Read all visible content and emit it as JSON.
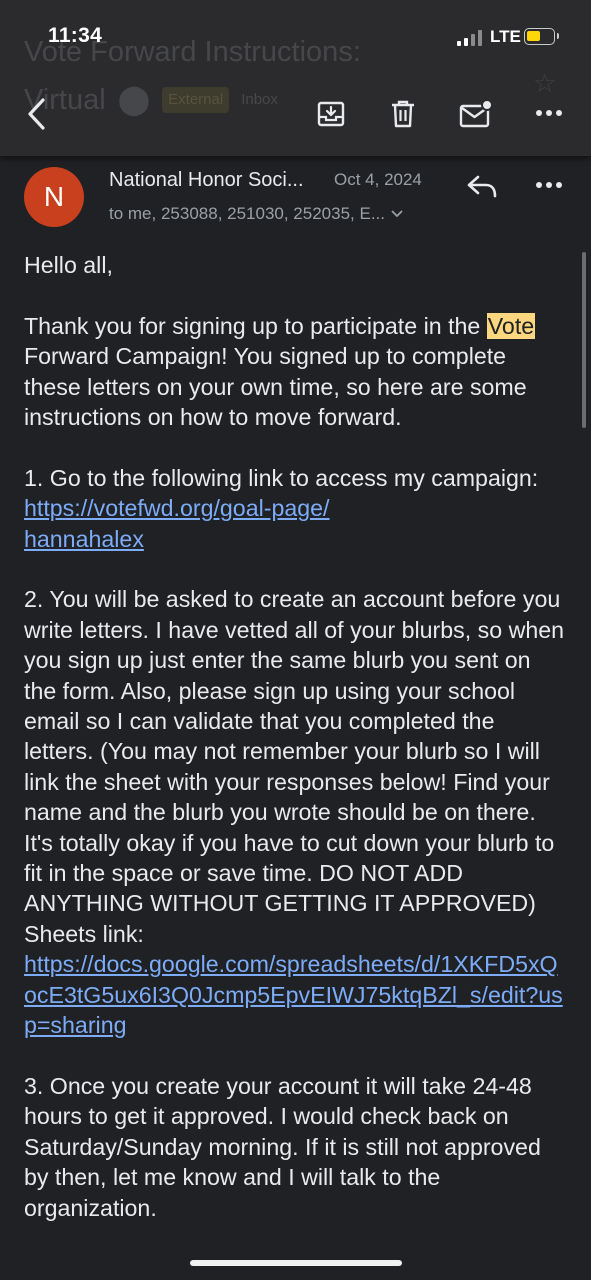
{
  "status_bar": {
    "time": "11:34",
    "network": "LTE"
  },
  "ghost_subject": {
    "line1": "Vote Forward Instructions:",
    "line2": "Virtual",
    "badge": "External",
    "label": "Inbox"
  },
  "toolbar": {
    "back_icon": "chevron-left-icon",
    "archive_icon": "archive-icon",
    "delete_icon": "trash-icon",
    "mark_unread_icon": "mail-unread-icon",
    "more_icon": "more-horizontal-icon"
  },
  "message": {
    "avatar_letter": "N",
    "avatar_color": "#c8401e",
    "sender": "National Honor Soci...",
    "date": "Oct 4, 2024",
    "recipients": "to me, 253088, 251030, 252035, E...",
    "greeting": "Hello all,",
    "p1_before": "Thank you for signing up to participate in the ",
    "p1_highlight": "Vote",
    "p1_after": " Forward Campaign! You signed up to complete these letters on your own time, so here are some instructions on how to move forward.",
    "p2_text": "1. Go to the following link to access my campaign: ",
    "p2_link": "https://votefwd.org/goal-page/hannahalex",
    "p3_text": "2. You will be asked to create an account before you write letters. I have vetted all of your blurbs, so when you sign up just enter the same blurb you sent on the form. Also, please sign up using your school email so I can validate that you completed the letters. (You may not remember your blurb so I will link the sheet with your responses below! Find your name and the blurb you wrote should be on there. It's totally okay if you have to cut down your blurb to fit in the space or save time. DO NOT ADD ANYTHING WITHOUT GETTING IT APPROVED)",
    "sheets_label": "Sheets link:",
    "sheets_link": "https://docs.google.com/spreadsheets/d/1XKFD5xQocE3tG5ux6I3Q0Jcmp5EpvEIWJ75ktqBZl_s/edit?usp=sharing",
    "p4_text": "3. Once you create your account it will take 24-48 hours to get it approved. I would check back on Saturday/Sunday morning. If it is still not approved by then, let me know and I will talk to the organization."
  },
  "colors": {
    "background": "#202124",
    "link": "#7cacf8",
    "highlight": "#fcd77f"
  }
}
